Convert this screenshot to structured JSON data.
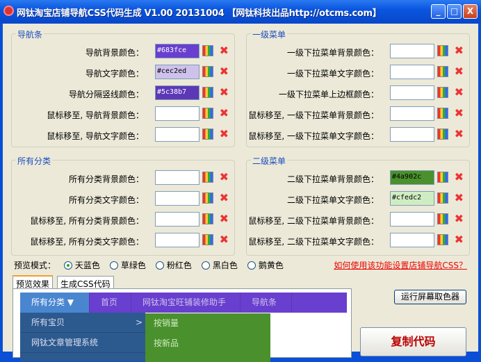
{
  "window": {
    "title": "网钛淘宝店铺导航CSS代码生成 V1.00 20131004 【网钛科技出品http://otcms.com】",
    "min": "_",
    "max": "□",
    "close": "X"
  },
  "groups": [
    {
      "title": "导航条",
      "rows": [
        {
          "label": "导航背景颜色：",
          "value": "#683fce",
          "bg": "#683fce",
          "fg": "#ffffff"
        },
        {
          "label": "导航文字颜色：",
          "value": "#cec2ed",
          "bg": "#cec2ed",
          "fg": "#000000"
        },
        {
          "label": "导航分隔竖线颜色：",
          "value": "#5c38b7",
          "bg": "#5c38b7",
          "fg": "#ffffff"
        },
        {
          "label": "鼠标移至, 导航背景颜色：",
          "value": "",
          "bg": "#ffffff",
          "fg": "#000000"
        },
        {
          "label": "鼠标移至, 导航文字颜色：",
          "value": "",
          "bg": "#ffffff",
          "fg": "#000000"
        }
      ]
    },
    {
      "title": "一级菜单",
      "rows": [
        {
          "label": "一级下拉菜单背景颜色：",
          "value": "",
          "bg": "#ffffff",
          "fg": "#000000"
        },
        {
          "label": "一级下拉菜单文字颜色：",
          "value": "",
          "bg": "#ffffff",
          "fg": "#000000"
        },
        {
          "label": "一级下拉菜单上边框颜色：",
          "value": "",
          "bg": "#ffffff",
          "fg": "#000000"
        },
        {
          "label": "鼠标移至, 一级下拉菜单背景颜色：",
          "value": "",
          "bg": "#ffffff",
          "fg": "#000000"
        },
        {
          "label": "鼠标移至, 一级下拉菜单文字颜色：",
          "value": "",
          "bg": "#ffffff",
          "fg": "#000000"
        }
      ]
    },
    {
      "title": "所有分类",
      "rows": [
        {
          "label": "所有分类背景颜色：",
          "value": "",
          "bg": "#ffffff",
          "fg": "#000000"
        },
        {
          "label": "所有分类文字颜色：",
          "value": "",
          "bg": "#ffffff",
          "fg": "#000000"
        },
        {
          "label": "鼠标移至, 所有分类背景颜色：",
          "value": "",
          "bg": "#ffffff",
          "fg": "#000000"
        },
        {
          "label": "鼠标移至, 所有分类文字颜色：",
          "value": "",
          "bg": "#ffffff",
          "fg": "#000000"
        }
      ]
    },
    {
      "title": "二级菜单",
      "rows": [
        {
          "label": "二级下拉菜单背景颜色：",
          "value": "#4a902c",
          "bg": "#4a902c",
          "fg": "#000000"
        },
        {
          "label": "二级下拉菜单文字颜色：",
          "value": "#cfedc2",
          "bg": "#cfedc2",
          "fg": "#000000"
        },
        {
          "label": "鼠标移至, 二级下拉菜单背景颜色：",
          "value": "",
          "bg": "#ffffff",
          "fg": "#000000"
        },
        {
          "label": "鼠标移至, 二级下拉菜单文字颜色：",
          "value": "",
          "bg": "#ffffff",
          "fg": "#000000"
        }
      ]
    }
  ],
  "preview_mode": {
    "label": "预览模式：",
    "options": [
      "天蓝色",
      "草绿色",
      "粉红色",
      "黑白色",
      "鹅黄色"
    ],
    "selected": 0
  },
  "help_link": "如何使用该功能设置店铺导航CSS？",
  "tabs": [
    "预览效果",
    "生成CSS代码"
  ],
  "preview": {
    "nav": [
      "所有分类 ▼",
      "首页",
      "网钛淘宝旺铺装修助手",
      "导航条"
    ],
    "sub": [
      "所有宝贝",
      "网钛文章管理系统"
    ],
    "arrow": ">",
    "sub2": [
      "按销量",
      "按新品"
    ]
  },
  "buttons": {
    "picker": "运行屏幕取色器",
    "copy": "复制代码"
  }
}
